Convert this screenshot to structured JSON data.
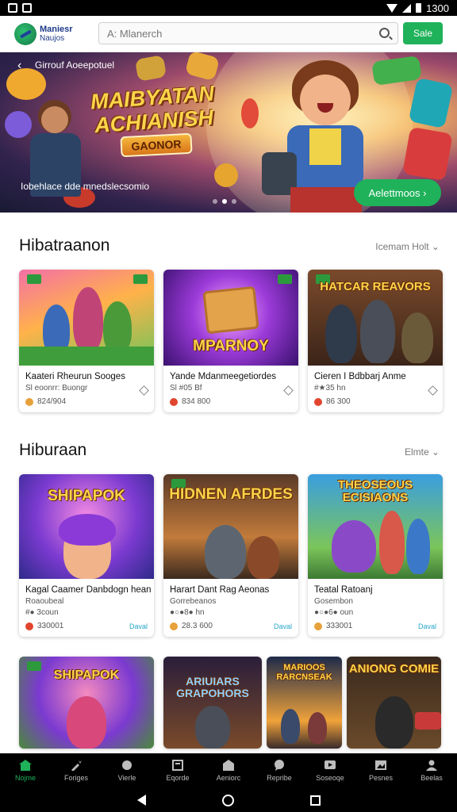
{
  "status": {
    "time": "1300"
  },
  "header": {
    "logo_line1": "Maniesr",
    "logo_line2": "Naujos",
    "search_placeholder": "A: Mlanerch",
    "sale_label": "Sale"
  },
  "hero": {
    "crumb": "Girrouf Aoeepotuel",
    "title": "MAIBYATAN ACHIANISH",
    "tag": "GAONOR",
    "caption": "Iobehlace dde mnedslecsomio",
    "cta": "Aelettmoos ›"
  },
  "sections": [
    {
      "title": "Hibatraanon",
      "link": "Icemam Holt ⌄",
      "cards": [
        {
          "name": "Kaateri Rheurun Sooges",
          "sub": "Sl eoonrr: Buongr",
          "price": "824/904",
          "tag": "",
          "art": "Family"
        },
        {
          "name": "Yande Mdanmeegetiordes",
          "sub": "Sl #05 Bf",
          "price": "834 800",
          "tag": "",
          "art": "MPARNOY"
        },
        {
          "name": "Cieren I Bdbbarj Anme",
          "sub": "#★35 hn",
          "price": "86 300",
          "tag": "",
          "art": "HATCAR REAVORS"
        }
      ]
    },
    {
      "title": "Hiburaan",
      "link": "Elmte ⌄",
      "cards": [
        {
          "name": "Kagal Caamer Danbdogn hean",
          "sub": "Roaoubeal",
          "sub2": "#● 3coun",
          "price": "330001",
          "tag": "Daval",
          "art": "SHIPAPOK"
        },
        {
          "name": "Harart Dant Rag Aeonas",
          "sub": "Gorrebeanos",
          "sub2": "●○●8● hn",
          "price": "28.3 600",
          "tag": "Daval",
          "art": "HIDNEN AFRDES"
        },
        {
          "name": "Teatal Ratoanj",
          "sub": "Gosembon",
          "sub2": "●○●6● oun",
          "price": "333001",
          "tag": "Daval",
          "art": "THEOSEOUS ECISIAONS"
        }
      ]
    }
  ],
  "bottom_row": [
    {
      "art": "SHIPAPOK"
    },
    {
      "art": "ARIUIARS GRAPOHORS"
    },
    {
      "art": "MARIOOS RARCNSEAK"
    },
    {
      "art": "ANIONG COMIE"
    }
  ],
  "nav": [
    {
      "label": "Nojme",
      "active": true
    },
    {
      "label": "Foriges"
    },
    {
      "label": "Vierle"
    },
    {
      "label": "Eqorde"
    },
    {
      "label": "Aeniorc"
    },
    {
      "label": "Repribe"
    },
    {
      "label": "Soseoqe"
    },
    {
      "label": "Pesnes"
    },
    {
      "label": "Beelas"
    }
  ],
  "colors": {
    "accent": "#1fb25a",
    "nav_bg": "#000000",
    "title_gold": "#fbd54a"
  }
}
